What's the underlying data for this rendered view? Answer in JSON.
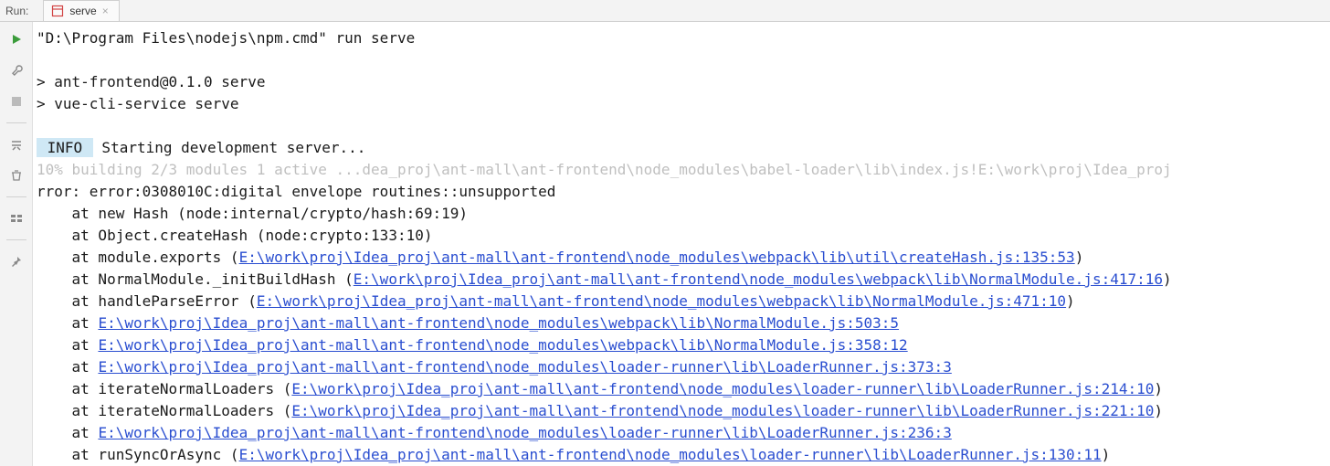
{
  "header": {
    "run_label": "Run:",
    "tab_name": "serve",
    "tab_close": "×"
  },
  "console": {
    "command": "\"D:\\Program Files\\nodejs\\npm.cmd\" run serve",
    "line_script1": "> ant-frontend@0.1.0 serve",
    "line_script2": "> vue-cli-service serve",
    "info_label": " INFO ",
    "info_text": " Starting development server...",
    "building_line": "10% building 2/3 modules 1 active ...dea_proj\\ant-mall\\ant-frontend\\node_modules\\babel-loader\\lib\\index.js!E:\\work\\proj\\Idea_proj",
    "error_line": "rror: error:0308010C:digital envelope routines::unsupported",
    "stack": [
      {
        "prefix": "    at new Hash (node:internal/crypto/hash:69:19)",
        "link": "",
        "suffix": ""
      },
      {
        "prefix": "    at Object.createHash (node:crypto:133:10)",
        "link": "",
        "suffix": ""
      },
      {
        "prefix": "    at module.exports (",
        "link": "E:\\work\\proj\\Idea_proj\\ant-mall\\ant-frontend\\node_modules\\webpack\\lib\\util\\createHash.js:135:53",
        "suffix": ")"
      },
      {
        "prefix": "    at NormalModule._initBuildHash (",
        "link": "E:\\work\\proj\\Idea_proj\\ant-mall\\ant-frontend\\node_modules\\webpack\\lib\\NormalModule.js:417:16",
        "suffix": ")"
      },
      {
        "prefix": "    at handleParseError (",
        "link": "E:\\work\\proj\\Idea_proj\\ant-mall\\ant-frontend\\node_modules\\webpack\\lib\\NormalModule.js:471:10",
        "suffix": ")"
      },
      {
        "prefix": "    at ",
        "link": "E:\\work\\proj\\Idea_proj\\ant-mall\\ant-frontend\\node_modules\\webpack\\lib\\NormalModule.js:503:5",
        "suffix": ""
      },
      {
        "prefix": "    at ",
        "link": "E:\\work\\proj\\Idea_proj\\ant-mall\\ant-frontend\\node_modules\\webpack\\lib\\NormalModule.js:358:12",
        "suffix": ""
      },
      {
        "prefix": "    at ",
        "link": "E:\\work\\proj\\Idea_proj\\ant-mall\\ant-frontend\\node_modules\\loader-runner\\lib\\LoaderRunner.js:373:3",
        "suffix": ""
      },
      {
        "prefix": "    at iterateNormalLoaders (",
        "link": "E:\\work\\proj\\Idea_proj\\ant-mall\\ant-frontend\\node_modules\\loader-runner\\lib\\LoaderRunner.js:214:10",
        "suffix": ")"
      },
      {
        "prefix": "    at iterateNormalLoaders (",
        "link": "E:\\work\\proj\\Idea_proj\\ant-mall\\ant-frontend\\node_modules\\loader-runner\\lib\\LoaderRunner.js:221:10",
        "suffix": ")"
      },
      {
        "prefix": "    at ",
        "link": "E:\\work\\proj\\Idea_proj\\ant-mall\\ant-frontend\\node_modules\\loader-runner\\lib\\LoaderRunner.js:236:3",
        "suffix": ""
      },
      {
        "prefix": "    at runSyncOrAsync (",
        "link": "E:\\work\\proj\\Idea_proj\\ant-mall\\ant-frontend\\node_modules\\loader-runner\\lib\\LoaderRunner.js:130:11",
        "suffix": ")"
      }
    ]
  }
}
